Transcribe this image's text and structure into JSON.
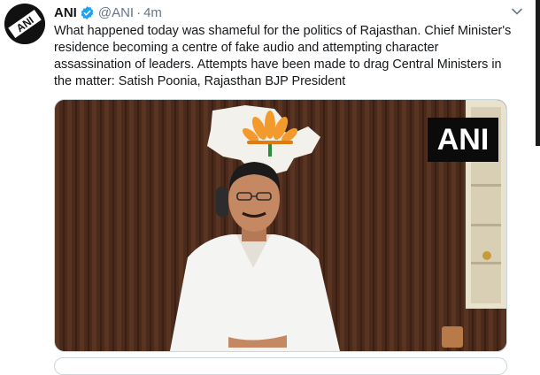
{
  "tweet": {
    "author_name": "ANI",
    "handle": "@ANI",
    "separator": "·",
    "timestamp": "4m",
    "text": "What happened today was shameful for the politics of Rajasthan. Chief Minister's residence becoming a centre of fake audio and attempting character assassination of leaders. Attempts have been made to drag Central Ministers in the matter: Satish Poonia, Rajasthan BJP President",
    "avatar_text": "ANI",
    "media": {
      "watermark": "ANI",
      "icon": "bjp-lotus-on-rajasthan-map"
    }
  },
  "colors": {
    "text": "#14171a",
    "secondary": "#657786",
    "verified": "#1da1f2",
    "border": "#ccd6dd"
  }
}
